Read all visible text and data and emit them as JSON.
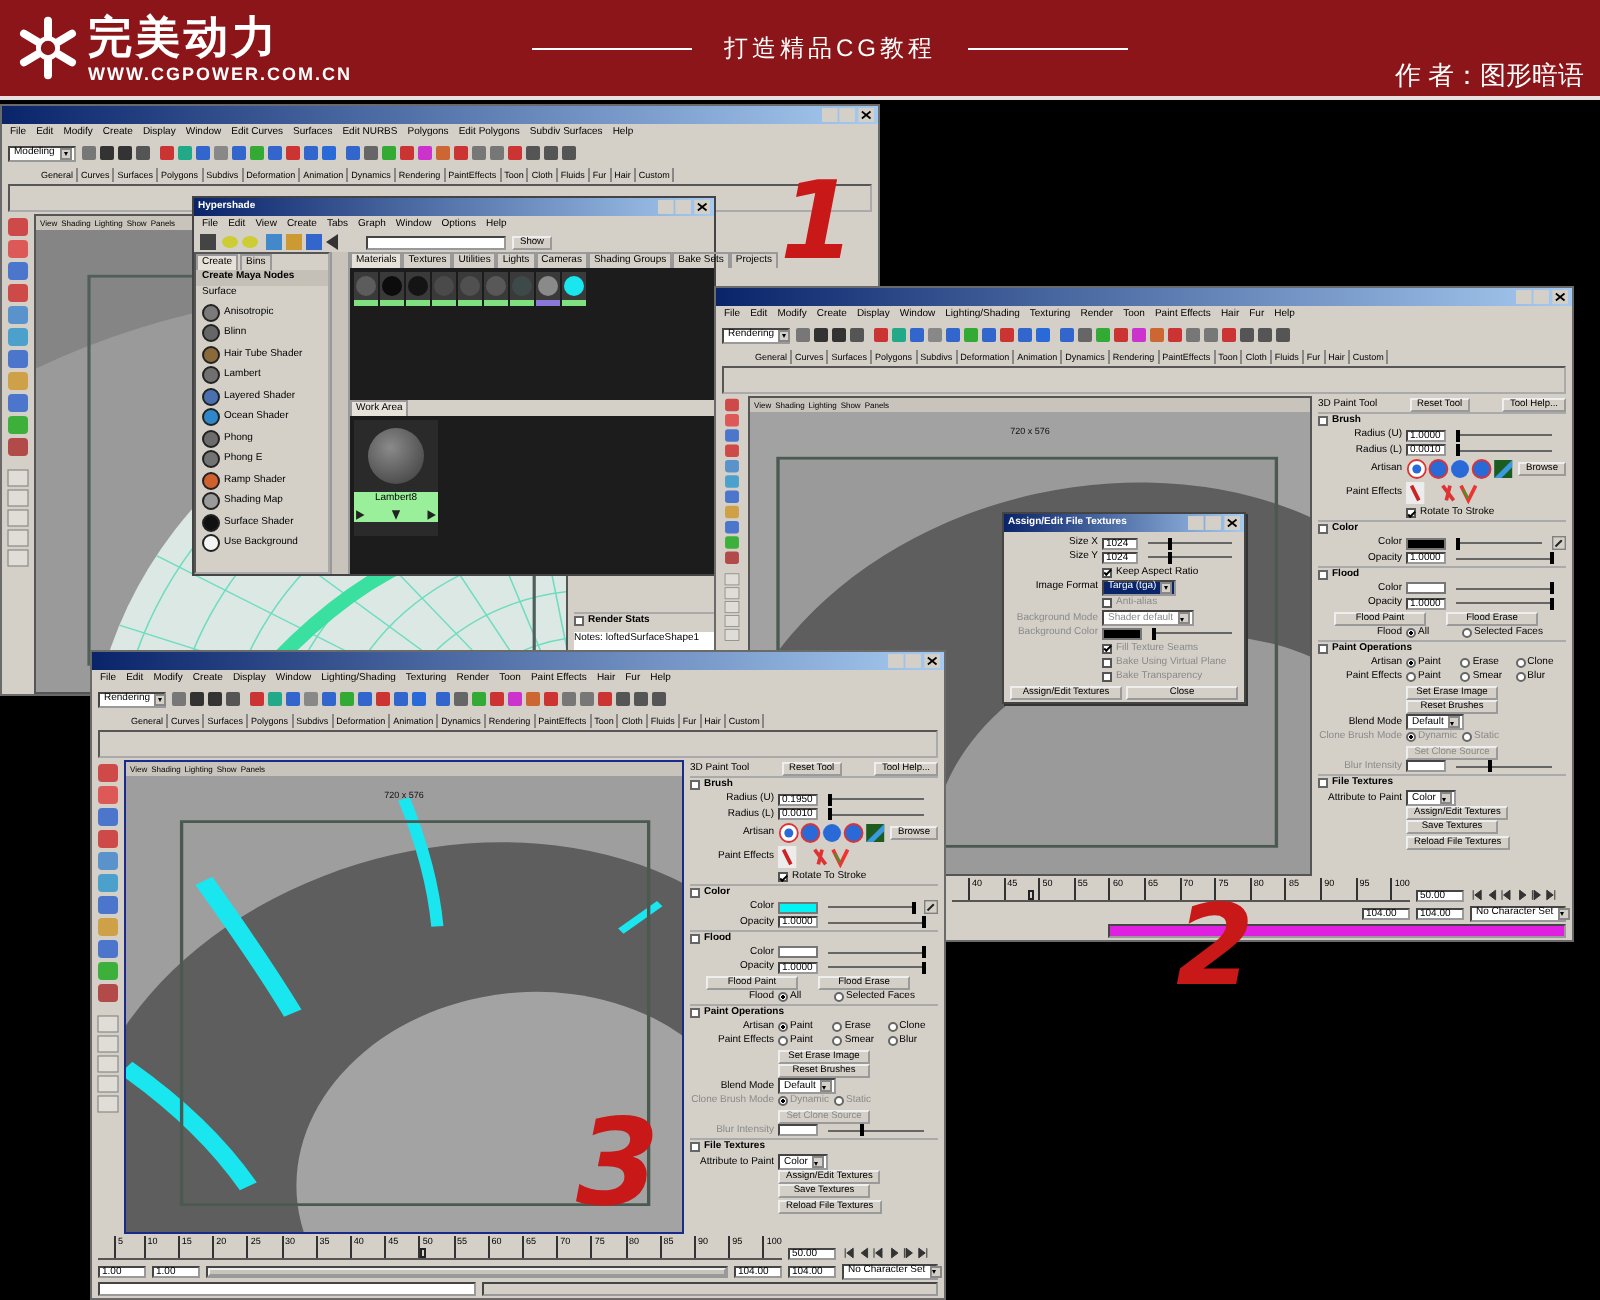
{
  "header": {
    "logo_text": "完美动力",
    "site": "WWW.CGPOWER.COM.CN",
    "slogan": "打造精品CG教程",
    "author": "作 者：图形暗语"
  },
  "windows": [
    {
      "mode": "Modeling",
      "viewport": {
        "kind": "wireframe"
      },
      "menus": [
        "File",
        "Edit",
        "Modify",
        "Create",
        "Display",
        "Window",
        "Edit Curves",
        "Surfaces",
        "Edit NURBS",
        "Polygons",
        "Edit Polygons",
        "Subdiv Surfaces",
        "Help"
      ],
      "shelf_tabs": [
        "General",
        "Curves",
        "Surfaces",
        "Polygons",
        "Subdivs",
        "Deformation",
        "Animation",
        "Dynamics",
        "Rendering",
        "PaintEffects",
        "Toon",
        "Cloth",
        "Fluids",
        "Fur",
        "Hair",
        "Custom"
      ],
      "panel_menus": [
        "View",
        "Shading",
        "Lighting",
        "Show",
        "Panels"
      ],
      "side": [
        {
          "kind": "section",
          "label": "Render Stats"
        },
        {
          "kind": "notes",
          "label": "Notes:  loftedSurfaceShape1"
        }
      ],
      "hypershade": {
        "title": "Hypershade",
        "menus": [
          "File",
          "Edit",
          "View",
          "Create",
          "Tabs",
          "Graph",
          "Window",
          "Options",
          "Help"
        ],
        "show": "Show",
        "left_tabs": [
          {
            "label": "Create",
            "selected": true
          },
          {
            "label": "Bins",
            "selected": false
          }
        ],
        "group": "Create Maya Nodes",
        "category": "Surface",
        "nodes": [
          {
            "label": "Anisotropic",
            "color": "#7a7a7a"
          },
          {
            "label": "Blinn",
            "color": "#666666"
          },
          {
            "label": "Hair Tube Shader",
            "color": "#8a6a3a"
          },
          {
            "label": "Lambert",
            "color": "#707070"
          },
          {
            "label": "Layered Shader",
            "color": "#4a70b0"
          },
          {
            "label": "Ocean Shader",
            "color": "#2f86c8"
          },
          {
            "label": "Phong",
            "color": "#6c6c6c"
          },
          {
            "label": "Phong E",
            "color": "#737373"
          },
          {
            "label": "Ramp Shader",
            "color": "#d0602e"
          },
          {
            "label": "Shading Map",
            "color": "#9a9a9a"
          },
          {
            "label": "Surface Shader",
            "color": "#111111"
          },
          {
            "label": "Use Background",
            "color": "#f4f4f4"
          }
        ],
        "tabs": [
          {
            "label": "Materials",
            "selected": true
          },
          {
            "label": "Textures",
            "selected": false
          },
          {
            "label": "Utilities",
            "selected": false
          },
          {
            "label": "Lights",
            "selected": false
          },
          {
            "label": "Cameras",
            "selected": false
          },
          {
            "label": "Shading Groups",
            "selected": false
          },
          {
            "label": "Bake Sets",
            "selected": false
          },
          {
            "label": "Projects",
            "selected": false
          }
        ],
        "swatches": [
          {
            "color": "#5c5c5c",
            "selected": false
          },
          {
            "color": "#0c0c0c",
            "selected": false
          },
          {
            "color": "#141414",
            "selected": false
          },
          {
            "color": "#4a4a4a",
            "selected": false
          },
          {
            "color": "#505050",
            "selected": false
          },
          {
            "color": "#585858",
            "selected": false
          },
          {
            "color": "#3e4a4a",
            "selected": false
          },
          {
            "color": "#8a8a8a",
            "selected": true
          },
          {
            "color": "#19e6ee",
            "selected": false
          }
        ],
        "work_tab": "Work Area",
        "work_node": "Lambert8"
      }
    },
    {
      "mode": "Rendering",
      "viewport": {
        "kind": "torus"
      },
      "resolution": "720 x 576",
      "menus": [
        "File",
        "Edit",
        "Modify",
        "Create",
        "Display",
        "Window",
        "Lighting/Shading",
        "Texturing",
        "Render",
        "Toon",
        "Paint Effects",
        "Hair",
        "Fur",
        "Help"
      ],
      "shelf_tabs": [
        "General",
        "Curves",
        "Surfaces",
        "Polygons",
        "Subdivs",
        "Deformation",
        "Animation",
        "Dynamics",
        "Rendering",
        "PaintEffects",
        "Toon",
        "Cloth",
        "Fluids",
        "Fur",
        "Hair",
        "Custom"
      ],
      "panel_menus": [
        "View",
        "Shading",
        "Lighting",
        "Show",
        "Panels"
      ],
      "side": [
        {
          "kind": "header",
          "label": "3D Paint Tool",
          "buttons": [
            "Reset Tool",
            "Tool Help..."
          ]
        },
        {
          "kind": "section",
          "label": "Brush"
        },
        {
          "kind": "slider",
          "label": "Radius (U)",
          "value": "1.0000",
          "level": 0.03
        },
        {
          "kind": "slider",
          "label": "Radius (L)",
          "value": "0.0010",
          "level": 0.03
        },
        {
          "kind": "icons",
          "label": "Artisan",
          "button": "Browse"
        },
        {
          "kind": "icons",
          "label": "Paint Effects"
        },
        {
          "kind": "check",
          "label": "Rotate To Stroke",
          "checked": true
        },
        {
          "kind": "section",
          "label": "Color"
        },
        {
          "kind": "swatch",
          "label": "Color",
          "color": "#000000",
          "level": 0.03,
          "picker": true
        },
        {
          "kind": "slider",
          "label": "Opacity",
          "value": "1.0000",
          "level": 1
        },
        {
          "kind": "section",
          "label": "Flood"
        },
        {
          "kind": "swatch",
          "label": "Color",
          "color": "#ffffff",
          "level": 1,
          "picker": false
        },
        {
          "kind": "slider",
          "label": "Opacity",
          "value": "1.0000",
          "level": 1
        },
        {
          "kind": "buttons",
          "buttons": [
            "Flood Paint",
            "Flood Erase"
          ]
        },
        {
          "kind": "radios",
          "label": "Flood",
          "options": [
            {
              "label": "All",
              "selected": true
            },
            {
              "label": "Selected Faces",
              "selected": false
            }
          ]
        },
        {
          "kind": "section",
          "label": "Paint Operations"
        },
        {
          "kind": "radios",
          "label": "Artisan",
          "options": [
            {
              "label": "Paint",
              "selected": true
            },
            {
              "label": "Erase",
              "selected": false
            },
            {
              "label": "Clone",
              "selected": false
            }
          ]
        },
        {
          "kind": "radios",
          "label": "Paint Effects",
          "options": [
            {
              "label": "Paint",
              "selected": false
            },
            {
              "label": "Smear",
              "selected": false
            },
            {
              "label": "Blur",
              "selected": false
            }
          ]
        },
        {
          "kind": "button",
          "label": "Set Erase Image"
        },
        {
          "kind": "button",
          "label": "Reset Brushes"
        },
        {
          "kind": "dropdown",
          "label": "Blend Mode",
          "value": "Default"
        },
        {
          "kind": "radios",
          "label": "Clone Brush Mode",
          "disabled": true,
          "options": [
            {
              "label": "Dynamic",
              "selected": true
            },
            {
              "label": "Static",
              "selected": false
            }
          ]
        },
        {
          "kind": "button",
          "label": "Set Clone Source",
          "disabled": true
        },
        {
          "kind": "slider",
          "label": "Blur Intensity",
          "level": 0.35,
          "disabled": true
        },
        {
          "kind": "section",
          "label": "File Textures"
        },
        {
          "kind": "dropdown",
          "label": "Attribute to Paint",
          "value": "Color"
        },
        {
          "kind": "button",
          "label": "Assign/Edit Textures"
        },
        {
          "kind": "button",
          "label": "Save Textures"
        },
        {
          "kind": "button",
          "label": "Reload File Textures"
        }
      ],
      "dialog": {
        "title": "Assign/Edit File Textures",
        "rows": [
          {
            "kind": "slider",
            "label": "Size X",
            "value": "1024",
            "level": 0.25
          },
          {
            "kind": "slider",
            "label": "Size Y",
            "value": "1024",
            "level": 0.25
          },
          {
            "kind": "check",
            "label": "Keep Aspect Ratio",
            "checked": true
          },
          {
            "kind": "dropdown",
            "label": "Image Format",
            "value": "Targa (tga)",
            "focused": true
          },
          {
            "kind": "check",
            "label": "Anti-alias",
            "checked": false,
            "disabled": true
          },
          {
            "kind": "dropdown",
            "label": "Background Mode",
            "value": "Shader default",
            "disabled": true
          },
          {
            "kind": "swatch",
            "label": "Background Color",
            "color": "#000000",
            "level": 0.03,
            "picker": false,
            "disabled": true
          },
          {
            "kind": "check",
            "label": "Fill Texture Seams",
            "checked": true,
            "disabled": true
          },
          {
            "kind": "check",
            "label": "Bake Using Virtual Plane",
            "checked": false,
            "disabled": true
          },
          {
            "kind": "check",
            "label": "Bake Transparency",
            "checked": false,
            "disabled": true
          },
          {
            "kind": "buttons",
            "buttons": [
              "Assign/Edit Textures",
              "Close"
            ]
          }
        ]
      },
      "timeline": {
        "level": 0.167,
        "ticks": [
          "40",
          "45",
          "50",
          "55",
          "60",
          "65",
          "70",
          "75",
          "80",
          "85",
          "90",
          "95",
          "100"
        ],
        "current": "50.00"
      },
      "range": {
        "fields": [
          "104.00",
          "104.00"
        ],
        "character_set": "No Character Set"
      },
      "help": {
        "warning": true
      }
    },
    {
      "mode": "Rendering",
      "viewport": {
        "kind": "painted"
      },
      "resolution": "720 x 576",
      "menus": [
        "File",
        "Edit",
        "Modify",
        "Create",
        "Display",
        "Window",
        "Lighting/Shading",
        "Texturing",
        "Render",
        "Toon",
        "Paint Effects",
        "Hair",
        "Fur",
        "Help"
      ],
      "shelf_tabs": [
        "General",
        "Curves",
        "Surfaces",
        "Polygons",
        "Subdivs",
        "Deformation",
        "Animation",
        "Dynamics",
        "Rendering",
        "PaintEffects",
        "Toon",
        "Cloth",
        "Fluids",
        "Fur",
        "Hair",
        "Custom"
      ],
      "panel_menus": [
        "View",
        "Shading",
        "Lighting",
        "Show",
        "Panels"
      ],
      "side": [
        {
          "kind": "header",
          "label": "3D Paint Tool",
          "buttons": [
            "Reset Tool",
            "Tool Help..."
          ]
        },
        {
          "kind": "section",
          "label": "Brush"
        },
        {
          "kind": "slider",
          "label": "Radius (U)",
          "value": "0.1950",
          "level": 0.03
        },
        {
          "kind": "slider",
          "label": "Radius (L)",
          "value": "0.0010",
          "level": 0.03
        },
        {
          "kind": "icons",
          "label": "Artisan",
          "button": "Browse"
        },
        {
          "kind": "icons",
          "label": "Paint Effects"
        },
        {
          "kind": "check",
          "label": "Rotate To Stroke",
          "checked": true
        },
        {
          "kind": "section",
          "label": "Color"
        },
        {
          "kind": "swatch",
          "label": "Color",
          "color": "#00f4f4",
          "level": 1,
          "picker": true
        },
        {
          "kind": "slider",
          "label": "Opacity",
          "value": "1.0000",
          "level": 1
        },
        {
          "kind": "section",
          "label": "Flood"
        },
        {
          "kind": "swatch",
          "label": "Color",
          "color": "#ffffff",
          "level": 1,
          "picker": false
        },
        {
          "kind": "slider",
          "label": "Opacity",
          "value": "1.0000",
          "level": 1
        },
        {
          "kind": "buttons",
          "buttons": [
            "Flood Paint",
            "Flood Erase"
          ]
        },
        {
          "kind": "radios",
          "label": "Flood",
          "options": [
            {
              "label": "All",
              "selected": true
            },
            {
              "label": "Selected Faces",
              "selected": false
            }
          ]
        },
        {
          "kind": "section",
          "label": "Paint Operations"
        },
        {
          "kind": "radios",
          "label": "Artisan",
          "options": [
            {
              "label": "Paint",
              "selected": true
            },
            {
              "label": "Erase",
              "selected": false
            },
            {
              "label": "Clone",
              "selected": false
            }
          ]
        },
        {
          "kind": "radios",
          "label": "Paint Effects",
          "options": [
            {
              "label": "Paint",
              "selected": false
            },
            {
              "label": "Smear",
              "selected": false
            },
            {
              "label": "Blur",
              "selected": false
            }
          ]
        },
        {
          "kind": "button",
          "label": "Set Erase Image"
        },
        {
          "kind": "button",
          "label": "Reset Brushes"
        },
        {
          "kind": "dropdown",
          "label": "Blend Mode",
          "value": "Default"
        },
        {
          "kind": "radios",
          "label": "Clone Brush Mode",
          "disabled": true,
          "options": [
            {
              "label": "Dynamic",
              "selected": true
            },
            {
              "label": "Static",
              "selected": false
            }
          ]
        },
        {
          "kind": "button",
          "label": "Set Clone Source",
          "disabled": true
        },
        {
          "kind": "slider",
          "label": "Blur Intensity",
          "level": 0.35,
          "disabled": true
        },
        {
          "kind": "section",
          "label": "File Textures"
        },
        {
          "kind": "dropdown",
          "label": "Attribute to Paint",
          "value": "Color"
        },
        {
          "kind": "button",
          "label": "Assign/Edit Textures"
        },
        {
          "kind": "button",
          "label": "Save Textures"
        },
        {
          "kind": "button",
          "label": "Reload File Textures"
        }
      ],
      "timeline": {
        "level": 0.47,
        "ticks": [
          "5",
          "10",
          "15",
          "20",
          "25",
          "30",
          "35",
          "40",
          "45",
          "50",
          "55",
          "60",
          "65",
          "70",
          "75",
          "80",
          "85",
          "90",
          "95",
          "100"
        ],
        "current": "50.00"
      },
      "range": {
        "level": 1,
        "start_fields": [
          "1.00",
          "1.00"
        ],
        "fields": [
          "104.00",
          "104.00"
        ],
        "character_set": "No Character Set"
      },
      "help": {
        "warning": false
      }
    }
  ],
  "annotations": [
    "1",
    "2",
    "3"
  ]
}
